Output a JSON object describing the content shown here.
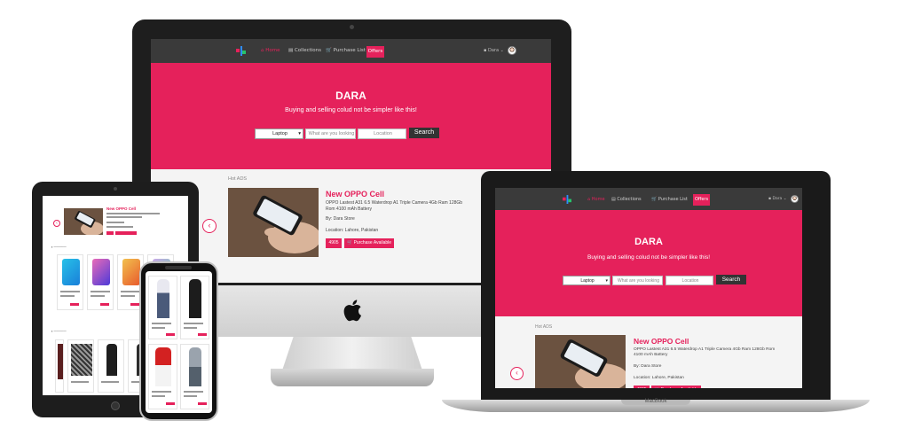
{
  "site": {
    "nav": {
      "home": "Home",
      "collections": "Collections",
      "purchase_list": "Purchase List",
      "offers": "Offers",
      "user": "Dara"
    },
    "hero": {
      "title": "DARA",
      "subtitle": "Buying and selling colud not be simpler like this!",
      "category_selected": "Laptop",
      "search_placeholder": "What are you looking",
      "location_placeholder": "Location",
      "search_button": "Search"
    },
    "section_label": "Hot ADS",
    "ad": {
      "title": "New OPPO Cell",
      "description": "OPPO Lastest A31 6.5 Waterdrop A1 Triple Camera 4Gb Ram 128Gb Rom 4100 mAh Battery",
      "by": "By: Dara Store",
      "location": "Location: Lahore, Pakistan",
      "price": "4905",
      "buy_button": "Purchase Available"
    }
  },
  "devices": {
    "laptop_label": "MacBook"
  },
  "colors": {
    "brand": "#e5215b",
    "nav": "#3a3a3a",
    "button_dark": "#333333"
  },
  "icons": [
    "logo-icon",
    "home-icon",
    "collections-icon",
    "cart-icon",
    "user-icon",
    "chevron-down-icon",
    "chevron-left-icon",
    "apple-logo-icon"
  ]
}
